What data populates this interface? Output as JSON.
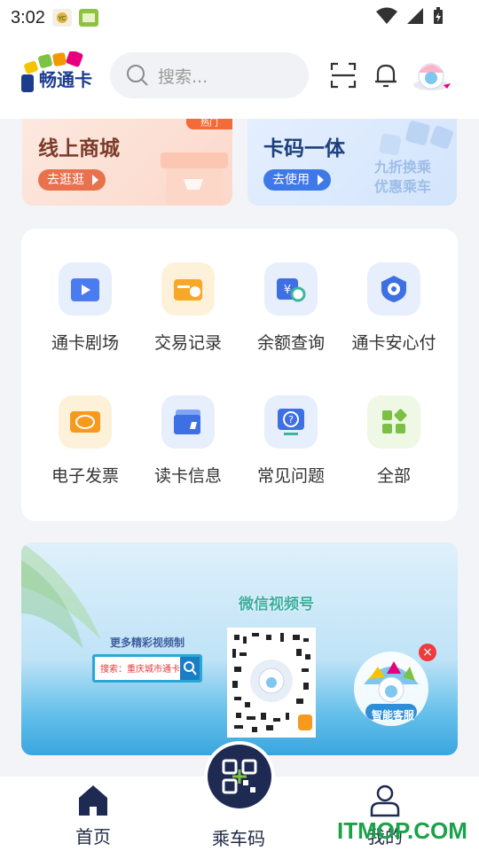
{
  "status_bar": {
    "time": "3:02"
  },
  "header": {
    "logo_text": "畅通卡",
    "search_placeholder": "搜索..."
  },
  "promos": {
    "mall": {
      "title": "线上商城",
      "button": "去逛逛",
      "badge": "热门"
    },
    "card_code": {
      "title": "卡码一体",
      "button": "去使用",
      "subtitle_line1": "九折换乘",
      "subtitle_line2": "优惠乘车"
    }
  },
  "services": [
    {
      "label": "通卡剧场",
      "icon": "theater-icon"
    },
    {
      "label": "交易记录",
      "icon": "transaction-record-icon"
    },
    {
      "label": "余额查询",
      "icon": "balance-query-icon"
    },
    {
      "label": "通卡安心付",
      "icon": "secure-pay-icon"
    },
    {
      "label": "电子发票",
      "icon": "e-invoice-icon"
    },
    {
      "label": "读卡信息",
      "icon": "read-card-icon"
    },
    {
      "label": "常见问题",
      "icon": "faq-icon"
    },
    {
      "label": "全部",
      "icon": "all-apps-icon"
    }
  ],
  "banner": {
    "wechat_title": "微信视频号",
    "more_text": "更多精彩视频制",
    "search_text": "搜索：重庆城市通卡",
    "cs_label": "智能客服"
  },
  "bottom_nav": {
    "home": "首页",
    "ride_code": "乘车码",
    "mine": "我的"
  },
  "watermark": "ITMOP.COM",
  "colors": {
    "brand_navy": "#1e2a52",
    "accent_orange": "#e8724e",
    "accent_blue": "#3f79e8",
    "watermark_green": "#1aa24a"
  }
}
